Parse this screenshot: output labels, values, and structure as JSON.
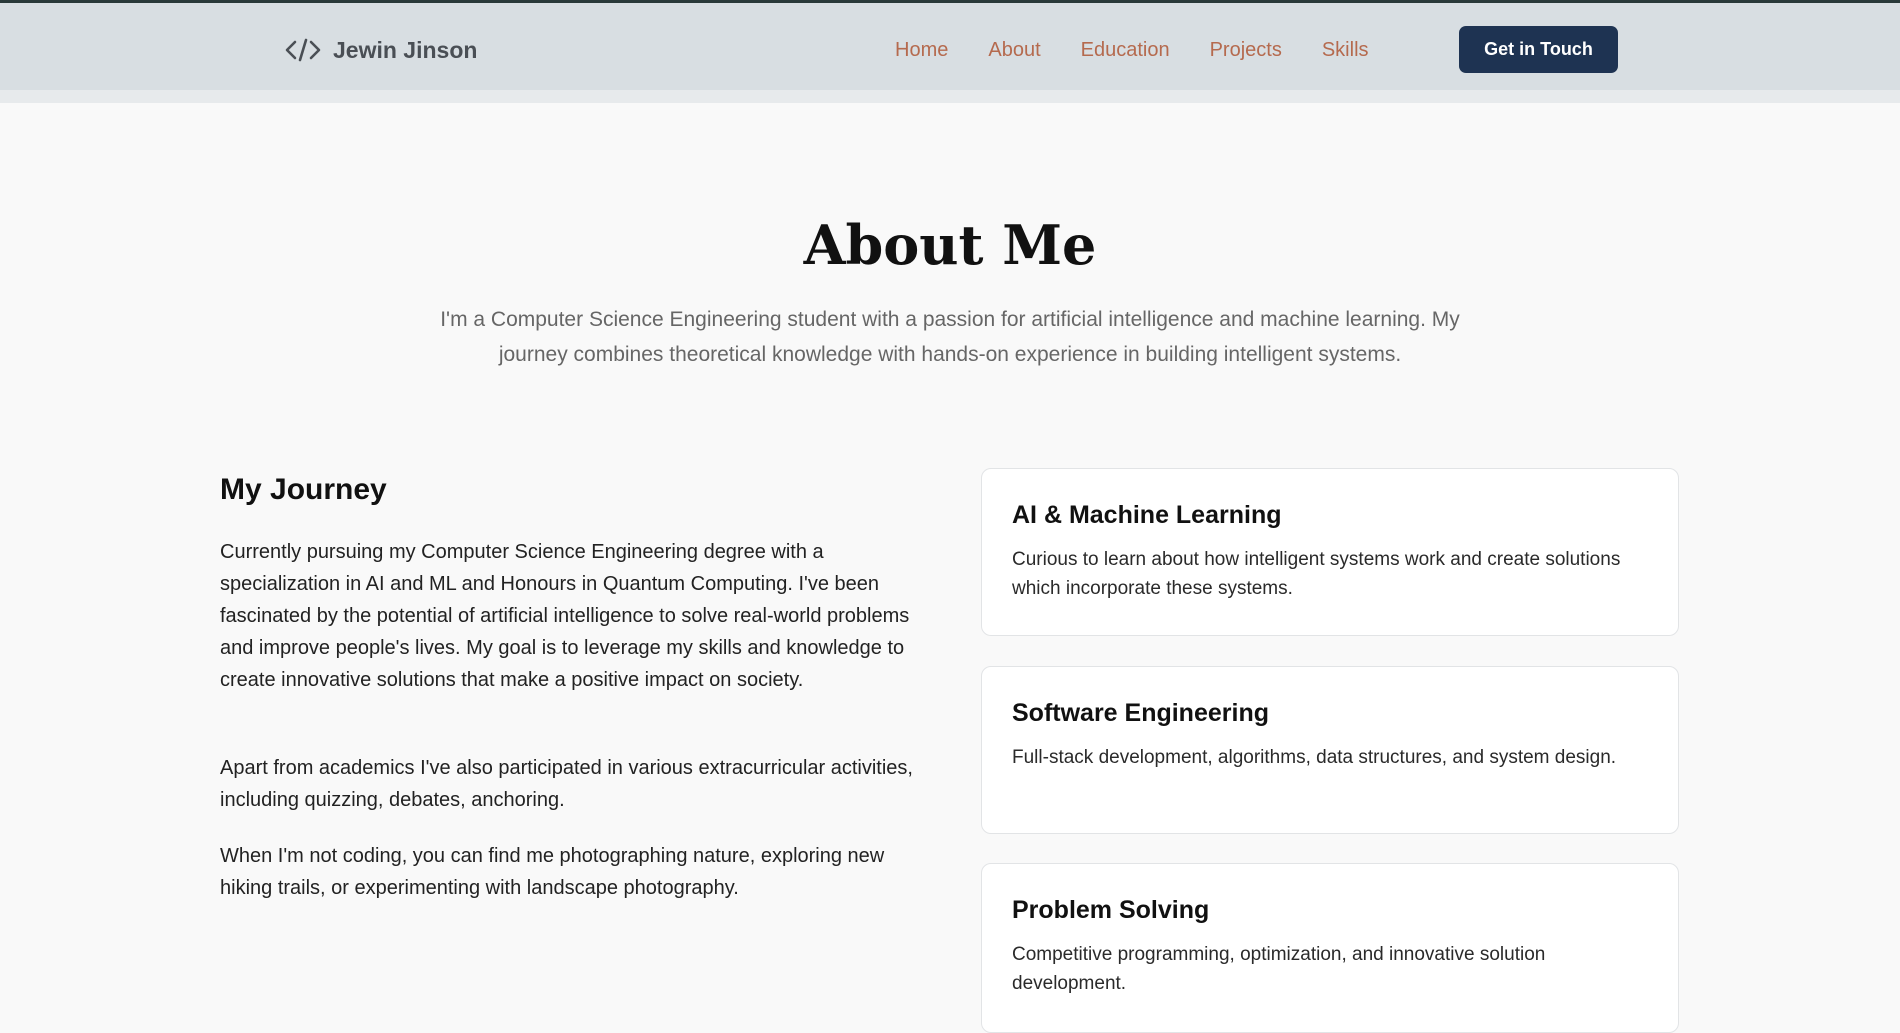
{
  "brand": {
    "icon": "code-icon",
    "name": "Jewin Jinson"
  },
  "nav": {
    "links": [
      "Home",
      "About",
      "Education",
      "Projects",
      "Skills"
    ],
    "cta_label": "Get in Touch"
  },
  "colors": {
    "nav_background": "#d8dee2",
    "nav_link": "#b56a4e",
    "cta_background": "#1e3352",
    "page_background": "#f9f9f9",
    "card_background": "#ffffff"
  },
  "about": {
    "title": "About Me",
    "intro": "I'm a Computer Science Engineering student with a passion for artificial intelligence and machine learning. My journey combines theoretical knowledge with hands-on experience in building intelligent systems."
  },
  "journey": {
    "title": "My Journey",
    "paragraphs": [
      "Currently pursuing my Computer Science Engineering degree with a specialization in AI and ML and Honours in Quantum Computing. I've been fascinated by the potential of artificial intelligence to solve real-world problems and improve people's lives. My goal is to leverage my skills and knowledge to create innovative solutions that make a positive impact on society.",
      "Apart from academics I've also participated in various extracurricular activities, including quizzing, debates, anchoring.",
      "When I'm not coding, you can find me photographing nature, exploring new hiking trails, or experimenting with landscape photography."
    ]
  },
  "cards": [
    {
      "title": "AI & Machine Learning",
      "description": "Curious to learn about how intelligent systems work and create solutions which incorporate these systems."
    },
    {
      "title": "Software Engineering",
      "description": "Full-stack development, algorithms, data structures, and system design."
    },
    {
      "title": "Problem Solving",
      "description": "Competitive programming, optimization, and innovative solution development."
    }
  ]
}
